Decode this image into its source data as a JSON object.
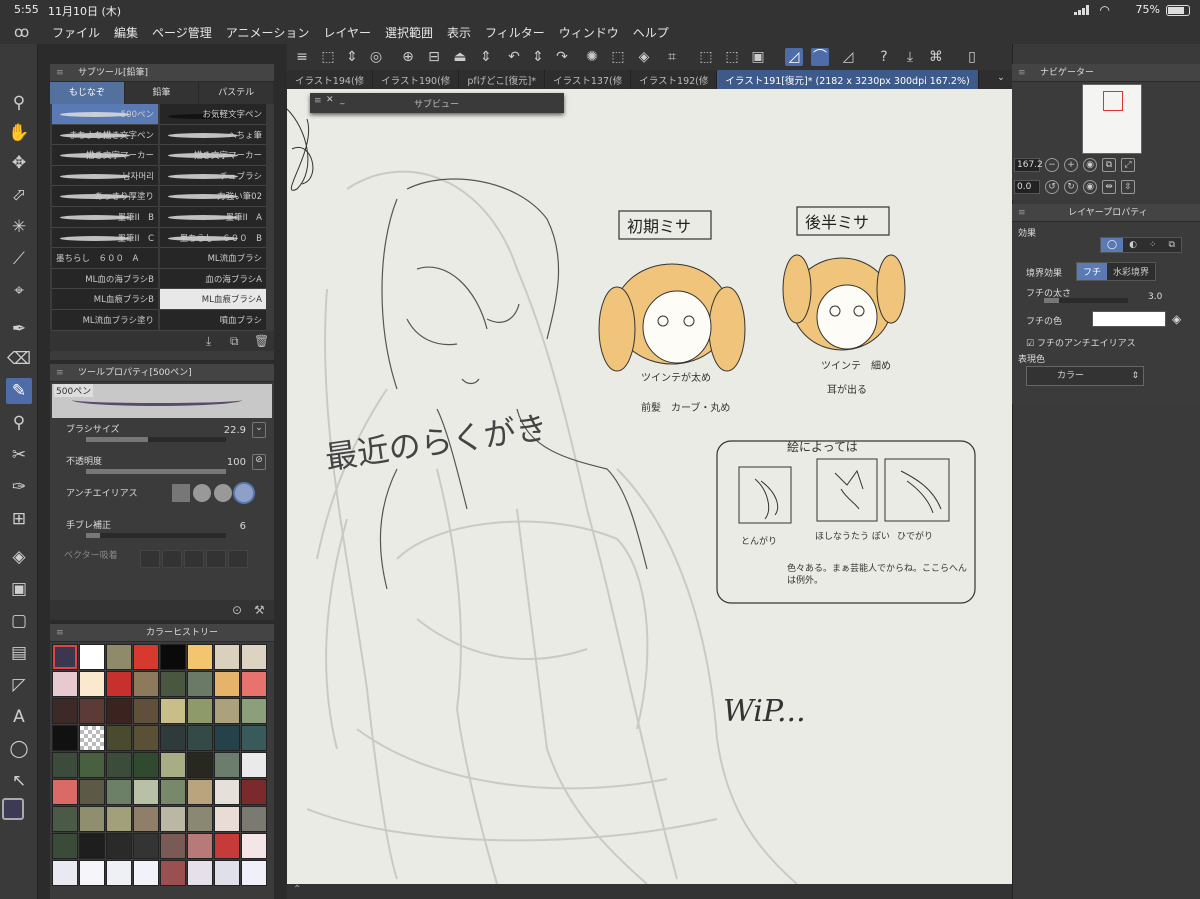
{
  "status": {
    "time": "5:55",
    "date": "11月10日 (木)",
    "battery": "75%"
  },
  "menu": [
    "ファイル",
    "編集",
    "ページ管理",
    "アニメーション",
    "レイヤー",
    "選択範囲",
    "表示",
    "フィルター",
    "ウィンドウ",
    "ヘルプ"
  ],
  "subtool": {
    "title": "サブツール[鉛筆]",
    "tabs": [
      "もじなぞ",
      "鉛筆",
      "パステル"
    ],
    "brushes": [
      "500ペン",
      "お気軽文字ペン",
      "まちよち描き文字ペン",
      "へちょ筆",
      "描き文字マーカー",
      "描き文字マーカー",
      "남자머리",
      "チュブラシ",
      "あっさり厚塗り",
      "力強い筆02",
      "墨筆II　B",
      "墨筆II　A",
      "墨筆II　C",
      "墨ちらし　６００　B",
      "墨ちらし　６００　A",
      "ML流血ブラシ",
      "ML血の海ブラシB",
      "血の海ブラシA",
      "ML血痕ブラシB",
      "ML血痕ブラシA",
      "ML流血ブラシ塗り",
      "噴血ブラシ"
    ]
  },
  "toolprop": {
    "title": "ツールプロパティ[500ペン]",
    "preview_label": "500ペン",
    "brush_size_label": "ブラシサイズ",
    "brush_size": "22.9",
    "opacity_label": "不透明度",
    "opacity": "100",
    "antialias_label": "アンチエイリアス",
    "stabilization_label": "手ブレ補正",
    "stabilization": "6",
    "vector_label": "ベクター吸着"
  },
  "colorhist": {
    "title": "カラーヒストリー",
    "colors": [
      "#3b3750",
      "#ffffff",
      "#8f8b6a",
      "#d63a2f",
      "#0a0a0a",
      "#f3c56e",
      "#d9d0bd",
      "#ddd3c3",
      "#e8c9cf",
      "#fbe9cf",
      "#c7302d",
      "#8d7a5c",
      "#4a5740",
      "#6a7a66",
      "#e6b36a",
      "#e8726d",
      "#3d2a26",
      "#5c3a35",
      "#3b2320",
      "#5f4f3b",
      "#c8be88",
      "#8f9a6a",
      "#aba27d",
      "#8a9f7a",
      "#111111",
      "checker",
      "#4a4a2e",
      "#5a5035",
      "#2e3b3a",
      "#344a47",
      "#25424a",
      "#395a5a",
      "#3d4b3d",
      "#48603f",
      "#3b4d3a",
      "#2f4a2f",
      "#a8ad85",
      "#27281f",
      "#6c7d6e",
      "#eaeaea",
      "#d96a66",
      "#5c5a47",
      "#6b8066",
      "#b9c0a8",
      "#78896b",
      "#b9a47e",
      "#e6e0da",
      "#7b2a2b",
      "#4b5a46",
      "#8f8f70",
      "#a2a07a",
      "#8f7e68",
      "#bbb7a5",
      "#8a8773",
      "#e9dbd6",
      "#7a7a70",
      "#3a4b3a",
      "#1e1e1e",
      "#2a2a2a",
      "#343434",
      "#7a5a55",
      "#b87a78",
      "#c73a3a",
      "#f4e6e6",
      "#e9e9f2",
      "#f5f5fa",
      "#eef0f6",
      "#f2f2fa",
      "#9a5050",
      "#e6e0ea",
      "#e0e0ea",
      "#f0f0fa"
    ]
  },
  "tabs": [
    "イラスト194(修",
    "イラスト190(修",
    "pfげどこ[復元]*",
    "イラスト137(修",
    "イラスト192(修",
    "イラスト191[復元]* (2182 x 3230px 300dpi 167.2%)"
  ],
  "subview": {
    "title": "サブビュー"
  },
  "canvas": {
    "title_early": "初期ミサ",
    "title_late": "後半ミサ",
    "note_left_1": "ツインテが太め",
    "note_left_2": "前髪　カーブ・丸め",
    "note_right_1": "ツインテ　細め",
    "note_right_2": "耳が出る",
    "box_title": "絵によっては",
    "box_label_1": "とんがり",
    "box_label_2": "ほしなうたう ぽい",
    "box_label_3": "ひでがり",
    "box_note": "色々ある。まぁ芸能人でからね。ここらへんは例外。",
    "doodle": "最近のらくがき",
    "wip": "WiP..."
  },
  "navigator": {
    "title": "ナビゲーター",
    "zoom": "167.2",
    "angle": "0.0"
  },
  "layerprop": {
    "title": "レイヤープロパティ",
    "effect_label": "効果",
    "border_label": "境界効果",
    "opt_edge": "フチ",
    "opt_watercolor": "水彩境界",
    "edge_width_label": "フチの太さ",
    "edge_width": "3.0",
    "edge_color_label": "フチの色",
    "edge_aa_label": "フチのアンチエイリアス",
    "expression_label": "表現色",
    "expression_value": "カラー"
  },
  "colors": {
    "accent": "#5a7ab5",
    "panel": "#3b3b3b",
    "canvas": "#ebebe6",
    "hair": "#f0c47a"
  }
}
